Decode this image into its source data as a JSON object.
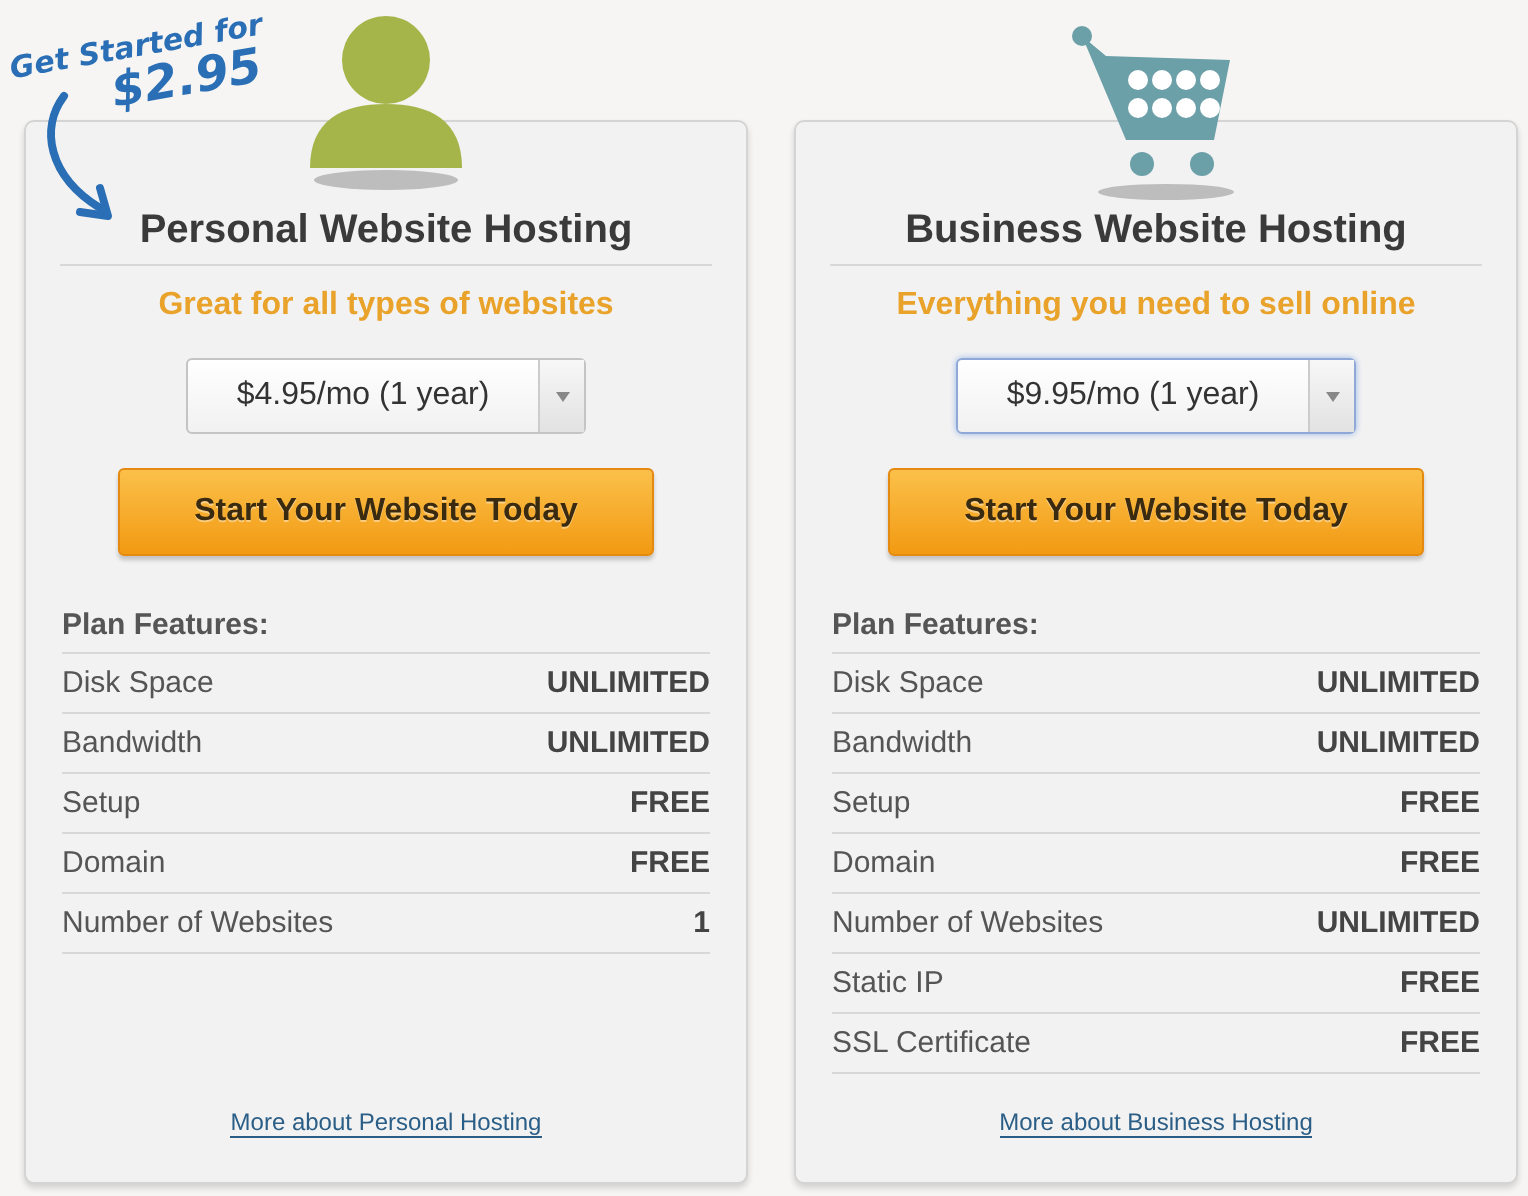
{
  "promo": {
    "line_1": "Get Started for",
    "line_2": "$2.95"
  },
  "plans": [
    {
      "kind": "person",
      "title": "Personal Website Hosting",
      "tagline": "Great for all types of websites",
      "price_select": {
        "value": "$4.95/mo (1 year)",
        "focused": false
      },
      "button": "Start Your Website Today",
      "features_heading": "Plan Features:",
      "features": [
        {
          "name": "Disk Space",
          "value": "UNLIMITED"
        },
        {
          "name": "Bandwidth",
          "value": "UNLIMITED"
        },
        {
          "name": "Setup",
          "value": "FREE"
        },
        {
          "name": "Domain",
          "value": "FREE"
        },
        {
          "name": "Number of Websites",
          "value": "1"
        }
      ],
      "more_link": "More about Personal Hosting"
    },
    {
      "kind": "cart",
      "title": "Business Website Hosting",
      "tagline": "Everything you need to sell online",
      "price_select": {
        "value": "$9.95/mo (1 year)",
        "focused": true
      },
      "button": "Start Your Website Today",
      "features_heading": "Plan Features:",
      "features": [
        {
          "name": "Disk Space",
          "value": "UNLIMITED"
        },
        {
          "name": "Bandwidth",
          "value": "UNLIMITED"
        },
        {
          "name": "Setup",
          "value": "FREE"
        },
        {
          "name": "Domain",
          "value": "FREE"
        },
        {
          "name": "Number of Websites",
          "value": "UNLIMITED"
        },
        {
          "name": "Static IP",
          "value": "FREE"
        },
        {
          "name": "SSL Certificate",
          "value": "FREE"
        }
      ],
      "more_link": "More about Business Hosting"
    }
  ]
}
